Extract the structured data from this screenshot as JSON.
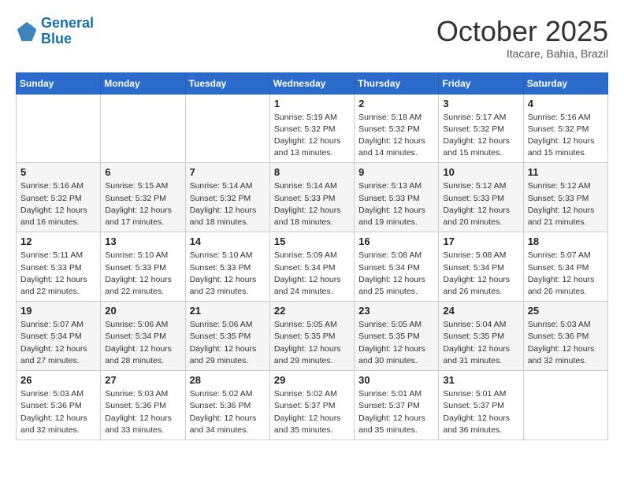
{
  "header": {
    "logo_line1": "General",
    "logo_line2": "Blue",
    "month": "October 2025",
    "location": "Itacare, Bahia, Brazil"
  },
  "weekdays": [
    "Sunday",
    "Monday",
    "Tuesday",
    "Wednesday",
    "Thursday",
    "Friday",
    "Saturday"
  ],
  "weeks": [
    [
      {
        "day": "",
        "info": ""
      },
      {
        "day": "",
        "info": ""
      },
      {
        "day": "",
        "info": ""
      },
      {
        "day": "1",
        "info": "Sunrise: 5:19 AM\nSunset: 5:32 PM\nDaylight: 12 hours\nand 13 minutes."
      },
      {
        "day": "2",
        "info": "Sunrise: 5:18 AM\nSunset: 5:32 PM\nDaylight: 12 hours\nand 14 minutes."
      },
      {
        "day": "3",
        "info": "Sunrise: 5:17 AM\nSunset: 5:32 PM\nDaylight: 12 hours\nand 15 minutes."
      },
      {
        "day": "4",
        "info": "Sunrise: 5:16 AM\nSunset: 5:32 PM\nDaylight: 12 hours\nand 15 minutes."
      }
    ],
    [
      {
        "day": "5",
        "info": "Sunrise: 5:16 AM\nSunset: 5:32 PM\nDaylight: 12 hours\nand 16 minutes."
      },
      {
        "day": "6",
        "info": "Sunrise: 5:15 AM\nSunset: 5:32 PM\nDaylight: 12 hours\nand 17 minutes."
      },
      {
        "day": "7",
        "info": "Sunrise: 5:14 AM\nSunset: 5:32 PM\nDaylight: 12 hours\nand 18 minutes."
      },
      {
        "day": "8",
        "info": "Sunrise: 5:14 AM\nSunset: 5:33 PM\nDaylight: 12 hours\nand 18 minutes."
      },
      {
        "day": "9",
        "info": "Sunrise: 5:13 AM\nSunset: 5:33 PM\nDaylight: 12 hours\nand 19 minutes."
      },
      {
        "day": "10",
        "info": "Sunrise: 5:12 AM\nSunset: 5:33 PM\nDaylight: 12 hours\nand 20 minutes."
      },
      {
        "day": "11",
        "info": "Sunrise: 5:12 AM\nSunset: 5:33 PM\nDaylight: 12 hours\nand 21 minutes."
      }
    ],
    [
      {
        "day": "12",
        "info": "Sunrise: 5:11 AM\nSunset: 5:33 PM\nDaylight: 12 hours\nand 22 minutes."
      },
      {
        "day": "13",
        "info": "Sunrise: 5:10 AM\nSunset: 5:33 PM\nDaylight: 12 hours\nand 22 minutes."
      },
      {
        "day": "14",
        "info": "Sunrise: 5:10 AM\nSunset: 5:33 PM\nDaylight: 12 hours\nand 23 minutes."
      },
      {
        "day": "15",
        "info": "Sunrise: 5:09 AM\nSunset: 5:34 PM\nDaylight: 12 hours\nand 24 minutes."
      },
      {
        "day": "16",
        "info": "Sunrise: 5:08 AM\nSunset: 5:34 PM\nDaylight: 12 hours\nand 25 minutes."
      },
      {
        "day": "17",
        "info": "Sunrise: 5:08 AM\nSunset: 5:34 PM\nDaylight: 12 hours\nand 26 minutes."
      },
      {
        "day": "18",
        "info": "Sunrise: 5:07 AM\nSunset: 5:34 PM\nDaylight: 12 hours\nand 26 minutes."
      }
    ],
    [
      {
        "day": "19",
        "info": "Sunrise: 5:07 AM\nSunset: 5:34 PM\nDaylight: 12 hours\nand 27 minutes."
      },
      {
        "day": "20",
        "info": "Sunrise: 5:06 AM\nSunset: 5:34 PM\nDaylight: 12 hours\nand 28 minutes."
      },
      {
        "day": "21",
        "info": "Sunrise: 5:06 AM\nSunset: 5:35 PM\nDaylight: 12 hours\nand 29 minutes."
      },
      {
        "day": "22",
        "info": "Sunrise: 5:05 AM\nSunset: 5:35 PM\nDaylight: 12 hours\nand 29 minutes."
      },
      {
        "day": "23",
        "info": "Sunrise: 5:05 AM\nSunset: 5:35 PM\nDaylight: 12 hours\nand 30 minutes."
      },
      {
        "day": "24",
        "info": "Sunrise: 5:04 AM\nSunset: 5:35 PM\nDaylight: 12 hours\nand 31 minutes."
      },
      {
        "day": "25",
        "info": "Sunrise: 5:03 AM\nSunset: 5:36 PM\nDaylight: 12 hours\nand 32 minutes."
      }
    ],
    [
      {
        "day": "26",
        "info": "Sunrise: 5:03 AM\nSunset: 5:36 PM\nDaylight: 12 hours\nand 32 minutes."
      },
      {
        "day": "27",
        "info": "Sunrise: 5:03 AM\nSunset: 5:36 PM\nDaylight: 12 hours\nand 33 minutes."
      },
      {
        "day": "28",
        "info": "Sunrise: 5:02 AM\nSunset: 5:36 PM\nDaylight: 12 hours\nand 34 minutes."
      },
      {
        "day": "29",
        "info": "Sunrise: 5:02 AM\nSunset: 5:37 PM\nDaylight: 12 hours\nand 35 minutes."
      },
      {
        "day": "30",
        "info": "Sunrise: 5:01 AM\nSunset: 5:37 PM\nDaylight: 12 hours\nand 35 minutes."
      },
      {
        "day": "31",
        "info": "Sunrise: 5:01 AM\nSunset: 5:37 PM\nDaylight: 12 hours\nand 36 minutes."
      },
      {
        "day": "",
        "info": ""
      }
    ]
  ]
}
